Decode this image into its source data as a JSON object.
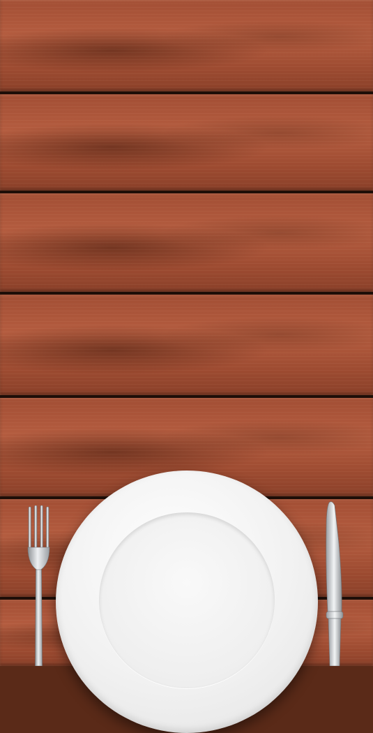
{
  "scene": {
    "description_tag": "place-setting",
    "colors": {
      "wood": "#a24e34",
      "wood_dark": "#5a2a18",
      "plank_gap": "#1e0e08",
      "plate": "#f3f3f3",
      "metal": "#c9ccd0"
    },
    "icons": {
      "fork": "fork-icon",
      "knife": "knife-icon",
      "plate": "plate-icon"
    }
  }
}
